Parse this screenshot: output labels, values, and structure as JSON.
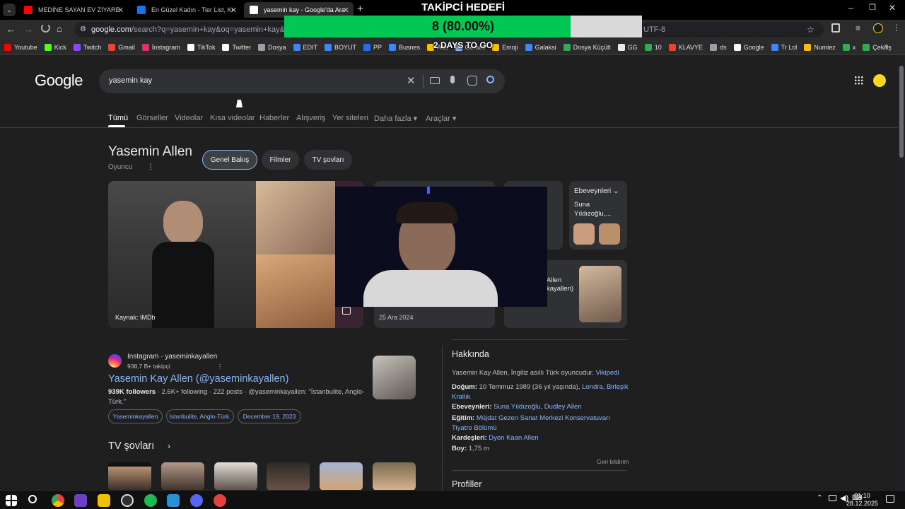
{
  "browser": {
    "tabs": [
      {
        "title": "MEDİNE SAYAN EV ZİYARETİ - Y",
        "favicon_color": "#ff0000"
      },
      {
        "title": "En Güzel Kadın - Tier List, Kör S",
        "favicon_color": "#1a73e8"
      },
      {
        "title": "yasemin kay - Google'da Ara",
        "favicon_color": "#ffffff",
        "active": true
      }
    ],
    "url_host": "google.com",
    "url_rest": "/search?q=yasemin+kay&oq=yasemin+kay&gs_lcrp=",
    "url_tail": "UTF-8",
    "bookmarks": [
      {
        "label": "Youtube",
        "color": "#ff0000"
      },
      {
        "label": "Kick",
        "color": "#53fc18"
      },
      {
        "label": "Twitch",
        "color": "#9146ff"
      },
      {
        "label": "Gmail",
        "color": "#ea4335"
      },
      {
        "label": "İnstagram",
        "color": "#e1306c"
      },
      {
        "label": "TikTok",
        "color": "#ffffff"
      },
      {
        "label": "Twitter",
        "color": "#ffffff"
      },
      {
        "label": "Dosya",
        "color": "#9aa0a6"
      },
      {
        "label": "EDIT",
        "color": "#4285f4"
      },
      {
        "label": "BOYUT",
        "color": "#4285f4"
      },
      {
        "label": "PP",
        "color": "#1a73e8"
      },
      {
        "label": "Busnes",
        "color": "#4285f4"
      },
      {
        "label": "Ads",
        "color": "#fbbc04"
      },
      {
        "label": "Gemini",
        "color": "#8ab4f8"
      },
      {
        "label": "Emoji",
        "color": "#fbbc04"
      },
      {
        "label": "Galaksi",
        "color": "#4285f4"
      },
      {
        "label": "Dosya Küçült",
        "color": "#34a853"
      },
      {
        "label": "GG",
        "color": "#e8eaed"
      },
      {
        "label": "10",
        "color": "#34a853"
      },
      {
        "label": "KLAVYE",
        "color": "#ea4335"
      },
      {
        "label": "ds",
        "color": "#9aa0a6"
      },
      {
        "label": "Google",
        "color": "#ffffff"
      },
      {
        "label": "Tr Lol",
        "color": "#4285f4"
      },
      {
        "label": "Numiez",
        "color": "#fbbc04"
      },
      {
        "label": "x",
        "color": "#34a853"
      },
      {
        "label": "Çekiliş",
        "color": "#34a853"
      }
    ]
  },
  "overlay": {
    "goal_title": "TAKİPCİ HEDEFİ",
    "goal_text": "8 (80.00%)",
    "goal_progress": 0.8,
    "days_text": "2 DAYS TO GO"
  },
  "search": {
    "logo": "Google",
    "query": "yasemin kay",
    "tabs": [
      "Tümü",
      "Görseller",
      "Videolar",
      "Kısa videolar",
      "Haberler",
      "Alışveriş",
      "Yer siteleri",
      "Daha fazla ▾",
      "Araçlar ▾"
    ]
  },
  "entity": {
    "name": "Yasemin Allen",
    "subtitle": "Oyuncu",
    "chips": [
      "Genel Bakış",
      "Filmler",
      "TV şovları"
    ],
    "image_source": "Kaynak: IMDb",
    "date": "25 Ara 2024",
    "partial_card_text": "Allen\nkayallen)",
    "parents_card": {
      "title": "Ebeveynleri",
      "name": "Suna Yıldızoğlu,..."
    }
  },
  "result": {
    "source": "Instagram · yaseminkayallen",
    "followers_line": "938,7 B+ takipçi",
    "title": "Yasemin Kay Allen (@yaseminkayallen)",
    "snippet_bold": "939K followers",
    "snippet": " · 2.6K+ following · 222 posts · @yaseminkayallen: \"İstanbulite, Anglo-Türk.\"",
    "tags": [
      "Yaseminkayallen",
      "İstanbulite, Anglo-Türk.",
      "December 19, 2023"
    ]
  },
  "tv": {
    "heading": "TV şovları"
  },
  "about": {
    "heading": "Hakkında",
    "desc": "Yasemin Kay Allen, İngiliz asıllı Türk oyuncudur.",
    "desc_link": "Vikipedi",
    "birth_label": "Doğum:",
    "birth_text": " 10 Temmuz 1989 (36 yıl yaşında), ",
    "birth_link": "Londra, Birleşik Krallık",
    "parents_label": "Ebeveynleri:",
    "parents_link": "Suna Yıldızoğlu, Dudley Allen",
    "edu_label": "Eğitim:",
    "edu_link": "Müjdat Gezen Sanat Merkezi Konservatuvarı Tiyatro Bölümü",
    "sibling_label": "Kardeşleri:",
    "sibling_link": "Dyon Kaan Allen",
    "height_label": "Boy:",
    "height_text": " 1,75 m",
    "feedback": "Geri bildirim",
    "profiles": "Profiller"
  },
  "taskbar": {
    "time": "01:10",
    "date": "28.12.2025"
  }
}
